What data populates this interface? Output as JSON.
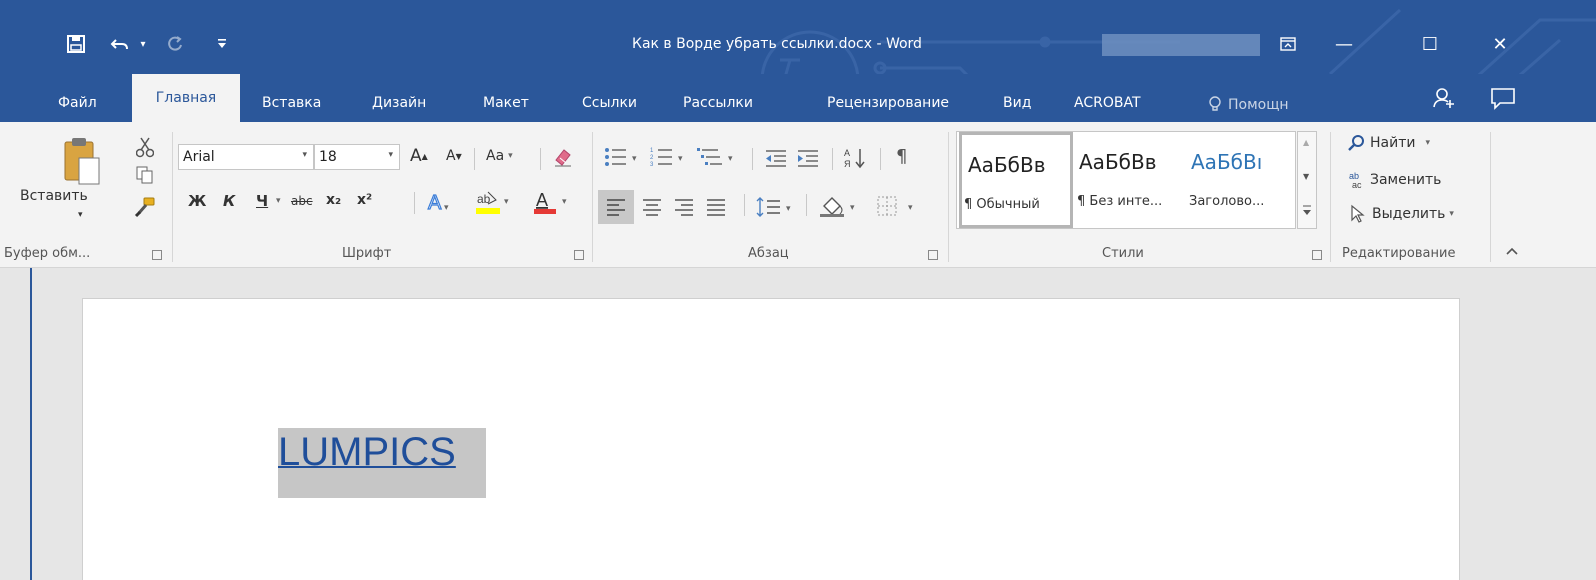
{
  "titlebar": {
    "title": "Как в Ворде убрать ссылки.docx - Word",
    "minimize": "—",
    "maximize": "☐",
    "close": "✕"
  },
  "tabs": [
    "Файл",
    "Главная",
    "Вставка",
    "Дизайн",
    "Макет",
    "Ссылки",
    "Рассылки",
    "Рецензирование",
    "Вид",
    "ACROBAT"
  ],
  "tell_me": "Помощн",
  "clipboard": {
    "paste_label": "Вставить",
    "group_label": "Буфер обм..."
  },
  "font": {
    "name": "Arial",
    "size": "18",
    "grow": "A",
    "shrink": "A",
    "case": "Aa",
    "bold": "Ж",
    "italic": "К",
    "underline": "Ч",
    "strike": "abc",
    "sub": "x₂",
    "sup": "x²",
    "color_letter": "A",
    "group_label": "Шрифт",
    "highlight_color": "#ffff00",
    "font_color": "#e53935"
  },
  "paragraph": {
    "group_label": "Абзац",
    "pilcrow": "¶"
  },
  "styles": {
    "group_label": "Стили",
    "items": [
      {
        "sample": "АаБбВв",
        "name": "¶ Обычный",
        "color": "#000000"
      },
      {
        "sample": "АаБбВв",
        "name": "¶ Без инте...",
        "color": "#000000"
      },
      {
        "sample": "АаБбВı",
        "name": "Заголово...",
        "color": "#2e74b5"
      }
    ]
  },
  "editing": {
    "find": "Найти",
    "replace": "Заменить",
    "select": "Выделить",
    "group_label": "Редактирование"
  },
  "document": {
    "link_text": "LUMPICS",
    "link_color": "#1f4e9a",
    "selection_color": "#c6c6c6"
  },
  "colors": {
    "brand": "#2b579a",
    "ribbon": "#f3f3f3"
  }
}
